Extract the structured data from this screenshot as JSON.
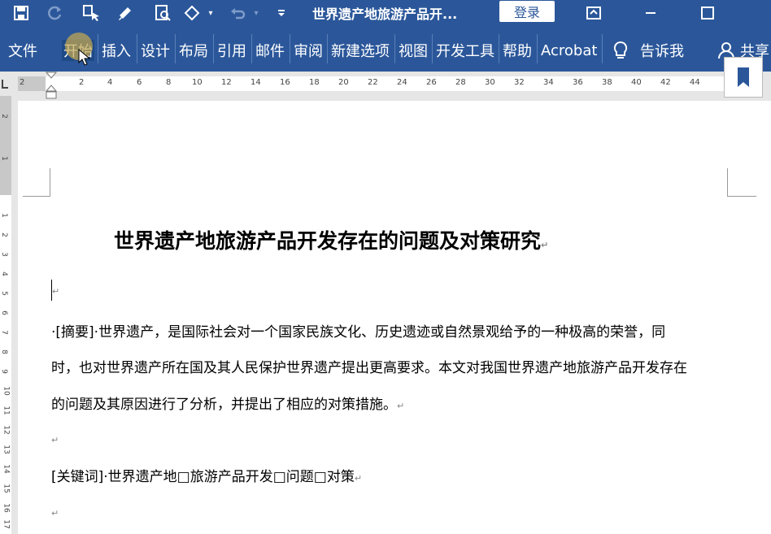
{
  "titlebar": {
    "title": "世界遗产地旅游产品开...",
    "login_label": "登录",
    "icons": [
      "save-icon",
      "redo-icon",
      "touch-mode-icon",
      "format-painter-icon",
      "print-preview-icon",
      "shapes-icon",
      "undo-icon",
      "customize-icon",
      "ribbon-display-icon",
      "minimize-icon",
      "maximize-icon"
    ]
  },
  "ribbon": {
    "tabs": [
      "文件",
      "开始",
      "插入",
      "设计",
      "布局",
      "引用",
      "邮件",
      "审阅",
      "新建选项",
      "视图",
      "开发工具",
      "帮助",
      "Acrobat"
    ],
    "tell_me": "告诉我",
    "share": "共享"
  },
  "ruler": {
    "labels": [
      "2",
      "2",
      "4",
      "6",
      "8",
      "10",
      "12",
      "14",
      "16",
      "18",
      "20",
      "22",
      "24",
      "26",
      "28",
      "30",
      "32",
      "34",
      "36",
      "38",
      "40",
      "42",
      "44"
    ]
  },
  "vruler": {
    "labels": [
      "2",
      "1",
      "1",
      "2",
      "3",
      "4",
      "5",
      "6",
      "7",
      "8",
      "9",
      "10",
      "11",
      "12",
      "13",
      "14",
      "15",
      "16",
      "17"
    ]
  },
  "document": {
    "title": "世界遗产地旅游产品开发存在的问题及对策研究",
    "abstract_line1": "·[摘要]·世界遗产，是国际社会对一个国家民族文化、历史遗迹或自然景观给予的一种极高的荣誉，同",
    "abstract_line2": "时，也对世界遗产所在国及其人民保护世界遗产提出更高要求。本文对我国世界遗产地旅游产品开发存在",
    "abstract_line3": "的问题及其原因进行了分析，并提出了相应的对策措施。",
    "keywords": "[关键词]·世界遗产地□旅游产品开发□问题□对策",
    "para_mark": "↵"
  }
}
